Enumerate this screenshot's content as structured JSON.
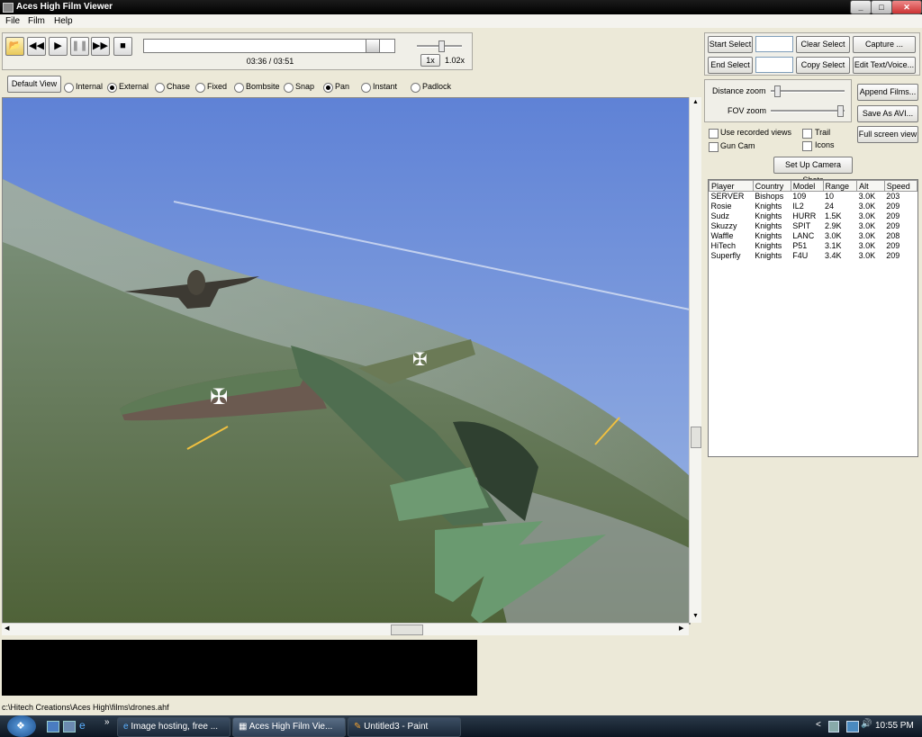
{
  "window": {
    "title": "Aces High Film Viewer",
    "min": "_",
    "max": "□",
    "close": "✕"
  },
  "menu": [
    "File",
    "Film",
    "Help"
  ],
  "playback": {
    "time": "03:36 / 03:51",
    "speed_button": "1x",
    "speed_value": "1.02x",
    "progress": 0.93
  },
  "view": {
    "default_button": "Default View",
    "options": [
      {
        "label": "Internal",
        "selected": false
      },
      {
        "label": "External",
        "selected": true
      },
      {
        "label": "Chase",
        "selected": false
      },
      {
        "label": "Fixed",
        "selected": false
      },
      {
        "label": "Bombsite",
        "selected": false
      },
      {
        "label": "Snap",
        "selected": false
      },
      {
        "label": "Pan",
        "selected": true
      },
      {
        "label": "Instant",
        "selected": false
      },
      {
        "label": "Padlock",
        "selected": false
      }
    ]
  },
  "selection": {
    "start_select": "Start Select",
    "end_select": "End Select",
    "clear_select": "Clear Select",
    "copy_select": "Copy Select ...",
    "capture": "Capture ...",
    "edit_text": "Edit Text/Voice..."
  },
  "zoom": {
    "distance_label": "Distance zoom",
    "fov_label": "FOV zoom",
    "distance_level": 0.05,
    "fov_level": 0.98
  },
  "actions": {
    "append_films": "Append Films...",
    "save_avi": "Save As AVI...",
    "full_screen": "Full screen view",
    "camera_shots": "Set Up Camera Shots"
  },
  "options": {
    "use_recorded_views": "Use recorded views",
    "gun_cam": "Gun Cam",
    "trail": "Trail",
    "icons": "Icons"
  },
  "players": {
    "columns": [
      "Player",
      "Country",
      "Model",
      "Range",
      "Alt",
      "Speed"
    ],
    "rows": [
      [
        "SERVER",
        "Bishops",
        "109",
        "10",
        "3.0K",
        "203"
      ],
      [
        "Rosie",
        "Knights",
        "IL2",
        "24",
        "3.0K",
        "209"
      ],
      [
        "Sudz",
        "Knights",
        "HURR",
        "1.5K",
        "3.0K",
        "209"
      ],
      [
        "Skuzzy",
        "Knights",
        "SPIT",
        "2.9K",
        "3.0K",
        "209"
      ],
      [
        "Waffle",
        "Knights",
        "LANC",
        "3.0K",
        "3.0K",
        "208"
      ],
      [
        "HiTech",
        "Knights",
        "P51",
        "3.1K",
        "3.0K",
        "209"
      ],
      [
        "Superfly",
        "Knights",
        "F4U",
        "3.4K",
        "3.0K",
        "209"
      ]
    ]
  },
  "status": {
    "path": "c:\\Hitech Creations\\Aces High\\films\\drones.ahf"
  },
  "taskbar": {
    "tasks": [
      "Image hosting, free ...",
      "Aces High Film Vie...",
      "Untitled3 - Paint"
    ],
    "overflow": "»",
    "clock": "10:55 PM",
    "tray_left": "<"
  },
  "colors": {
    "sky": "#6e8fd6",
    "ground": "#5e7048",
    "accent": "#0a246a"
  }
}
